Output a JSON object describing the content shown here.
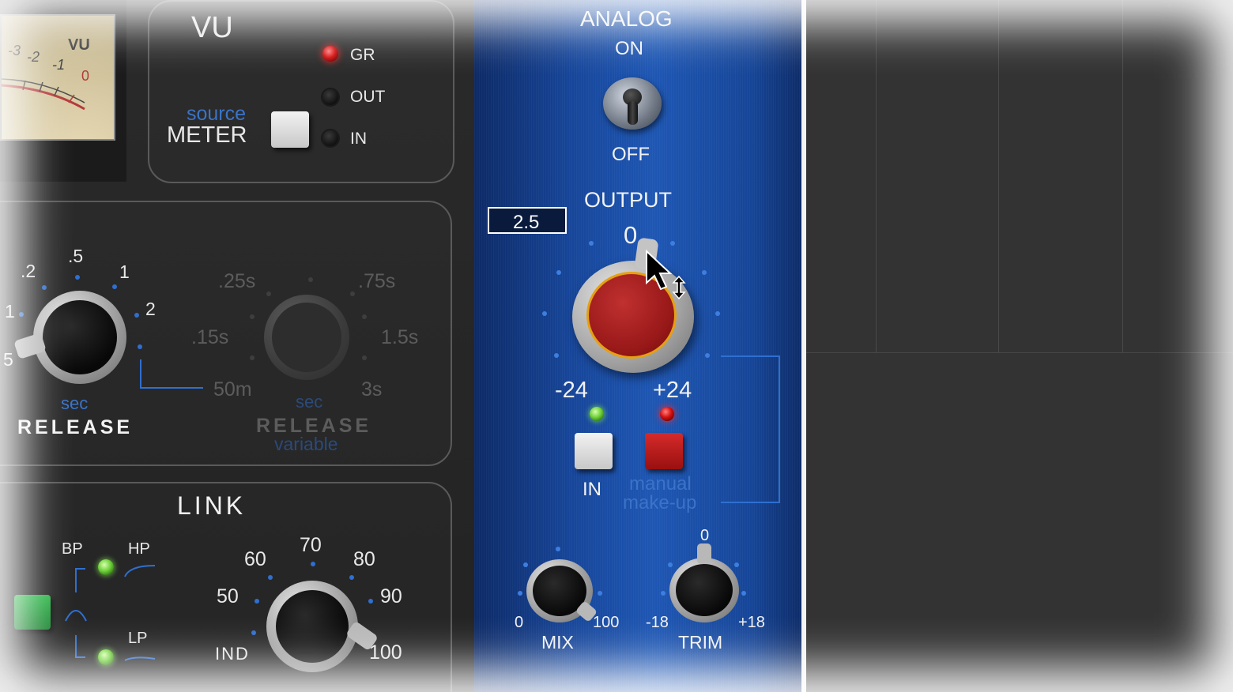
{
  "vu": {
    "title": "VU",
    "meter_face_label": "VU",
    "meter_scale": [
      "-3",
      "-2",
      "-1",
      "0"
    ],
    "leds": [
      "GR",
      "OUT",
      "IN"
    ],
    "source_label": "source",
    "meter_label": "METER"
  },
  "release": {
    "fixed": {
      "scale": [
        ".2",
        ".5",
        "1",
        "2",
        "1",
        "5"
      ],
      "unit": "sec",
      "label": "RELEASE"
    },
    "variable": {
      "scale": [
        ".25s",
        ".75s",
        ".15s",
        "1.5s",
        "50m",
        "3s"
      ],
      "unit": "sec",
      "label": "RELEASE",
      "sublabel": "variable"
    }
  },
  "link": {
    "title": "LINK",
    "filter_labels": [
      "BP",
      "HP",
      "LP"
    ],
    "scale": [
      "70",
      "60",
      "80",
      "50",
      "90",
      "IND",
      "100"
    ]
  },
  "analog": {
    "title": "ANALOG",
    "on_label": "ON",
    "off_label": "OFF"
  },
  "output": {
    "title": "OUTPUT",
    "zero_label": "0",
    "min_label": "-24",
    "max_label": "+24",
    "value_readout": "2.5",
    "in_button_label": "IN",
    "manual_label": "manual",
    "makeup_label": "make-up"
  },
  "mix": {
    "label": "MIX",
    "min": "0",
    "max": "100"
  },
  "trim": {
    "label": "TRIM",
    "zero": "0",
    "min": "-18",
    "max": "+18"
  },
  "colors": {
    "panel_blue": "#1e57b4",
    "led_red": "#d41010",
    "led_green": "#6fd13a",
    "output_knob_red": "#a01c1c",
    "accent_blue_text": "#3a73c8"
  },
  "icons": {
    "cursor": "arrow-pointer-icon",
    "resize": "vertical-resize-icon"
  }
}
